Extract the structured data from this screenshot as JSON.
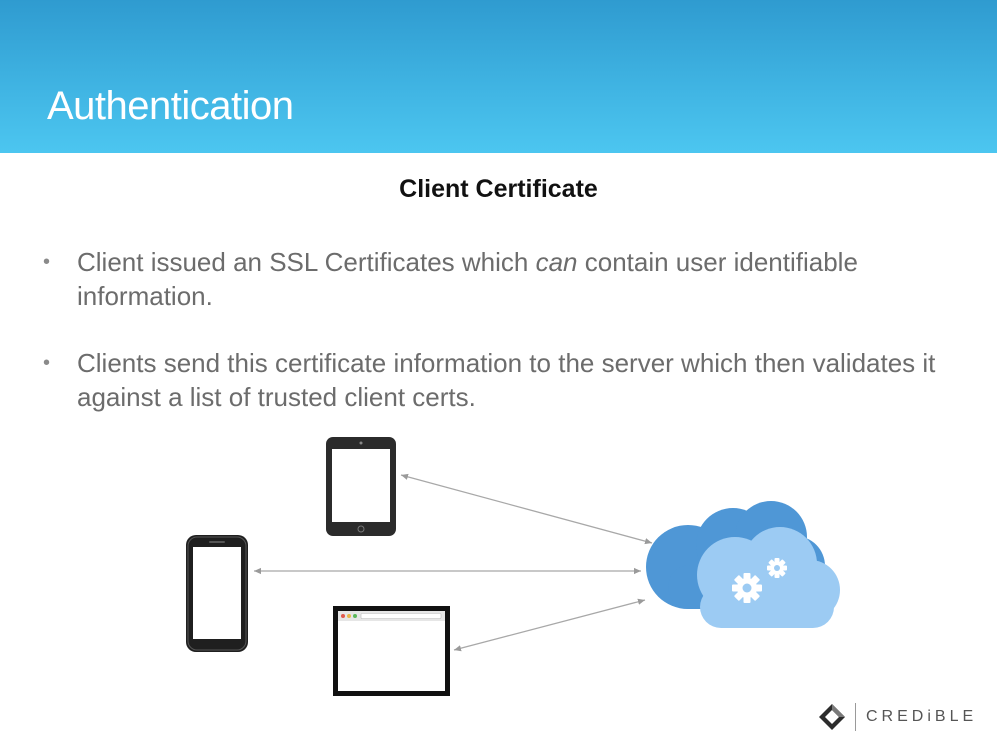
{
  "slide": {
    "title": "Authentication",
    "subtitle": "Client Certificate",
    "bullets": [
      {
        "before": "Client issued an SSL Certificates which ",
        "emphasis": "can",
        "after": " contain user identifiable information."
      },
      {
        "before": "Clients send this certificate information to the server which then validates it against a list of trusted client certs.",
        "emphasis": "",
        "after": ""
      }
    ],
    "bullet_glyph": "•"
  },
  "diagram": {
    "devices": [
      "tablet-icon",
      "smartphone-icon",
      "browser-window-icon"
    ],
    "server": "cloud-gears-icon",
    "connection": "bidirectional-arrow"
  },
  "logo": {
    "text": "CREDiBLE",
    "icon": "credible-diamond-icon"
  },
  "colors": {
    "header_top": "#2f9bd0",
    "header_bottom": "#4cc6f0",
    "cloud_dark": "#4f97d6",
    "cloud_light": "#9ccbf3",
    "body_text": "#6c6c6c"
  }
}
